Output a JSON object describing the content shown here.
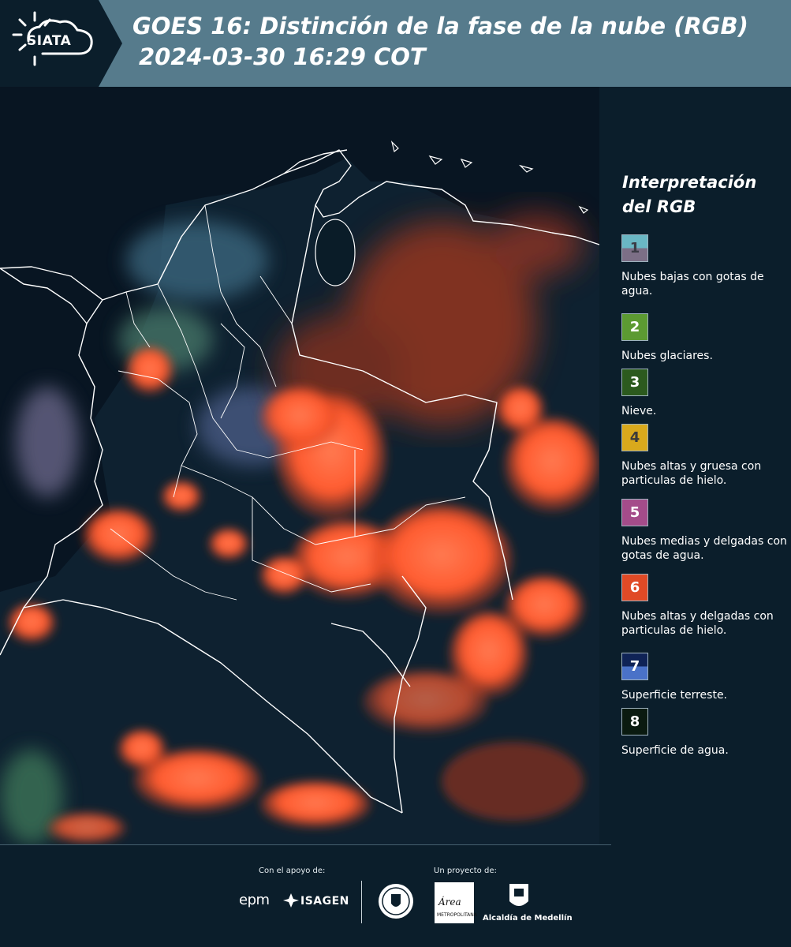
{
  "header": {
    "logo_text": "SIATA",
    "title_line1": "GOES 16: Distinción de la fase de la nube (RGB)",
    "title_line2": "2024-03-30 16:29 COT"
  },
  "legend": {
    "title_line1": "Interpretación",
    "title_line2": "del RGB",
    "items": [
      {
        "number": "1",
        "label": "Nubes bajas con gotas de agua.",
        "color_top": "#6ab7c4",
        "color_bottom": "#7c6f86",
        "num_color": "#3c3c46"
      },
      {
        "number": "2",
        "label": "Nubes glaciares.",
        "color_top": "#5c9a32",
        "color_bottom": "#5c9a32",
        "num_color": "#ffffff"
      },
      {
        "number": "3",
        "label": "Nieve.",
        "color_top": "#2c5a1e",
        "color_bottom": "#2c5a1e",
        "num_color": "#ffffff"
      },
      {
        "number": "4",
        "label": "Nubes altas y gruesa con particulas de hielo.",
        "color_top": "#d9a91c",
        "color_bottom": "#d9a91c",
        "num_color": "#3a3a3a"
      },
      {
        "number": "5",
        "label": "Nubes medias y delgadas con gotas de agua.",
        "color_top": "#a44c8a",
        "color_bottom": "#a44c8a",
        "num_color": "#ffffff"
      },
      {
        "number": "6",
        "label": "Nubes altas y delgadas con particulas de hielo.",
        "color_top": "#e04a26",
        "color_bottom": "#e04a26",
        "num_color": "#ffffff"
      },
      {
        "number": "7",
        "label": "Superficie terreste.",
        "color_top": "#0f2356",
        "color_bottom": "#4a72c8",
        "num_color": "#ffffff"
      },
      {
        "number": "8",
        "label": "Superficie de agua.",
        "color_top": "#0a1a10",
        "color_bottom": "#0a1a10",
        "num_color": "#ffffff"
      }
    ]
  },
  "footer": {
    "support_label": "Con el apoyo de:",
    "project_label": "Un proyecto de:",
    "sponsor_1": "epm",
    "sponsor_2": "ISAGEN",
    "partner_area_name": "Área",
    "partner_area_sub": "METROPOLITANA",
    "partner_3": "Alcaldía de Medellín"
  },
  "colors": {
    "header_bg": "#567b8c",
    "page_bg": "#0b1e2b",
    "cloud_orange": "#ff5a2e",
    "cloud_red": "#c23a1c",
    "land_dark": "#0d1d2a"
  }
}
